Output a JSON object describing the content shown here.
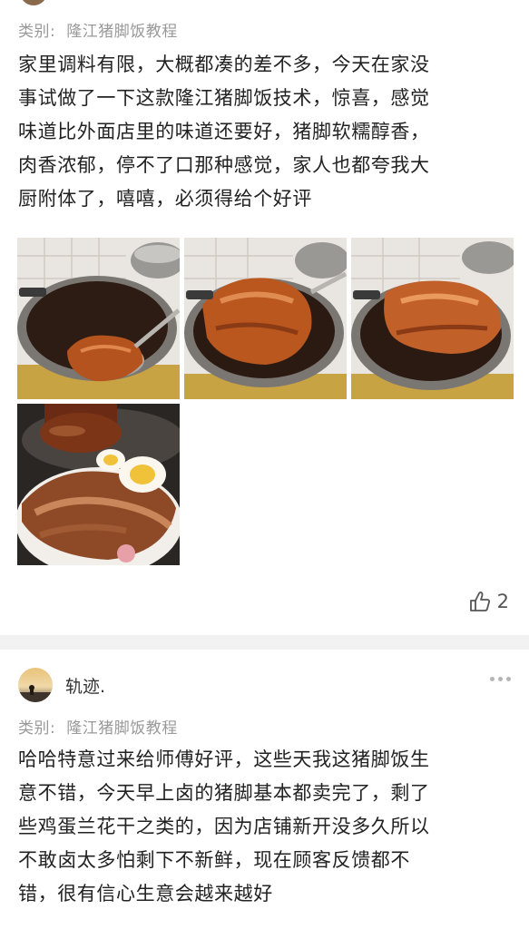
{
  "post1": {
    "category_label": "类别:",
    "category_value": "隆江猪脚饭教程",
    "review_lines": [
      "家里调料有限，大概都凑的差不多，今天在家没",
      "事试做了一下这款隆江猪脚饭技术，惊喜，感觉",
      "味道比外面店里的味道还要好，猪脚软糯醇香，",
      "肉香浓郁，停不了口那种感觉，家人也都夸我大",
      "厨附体了，嘻嘻，必须得给个好评"
    ],
    "photos": [
      "pot-photo-1",
      "pot-photo-2",
      "pot-photo-3",
      "rice-bowl-photo"
    ],
    "like_icon": "thumbs-up-icon",
    "like_count": "2"
  },
  "post2": {
    "username": "轨迹.",
    "more_icon": "more-dots-icon",
    "category_label": "类别:",
    "category_value": "隆江猪脚饭教程",
    "review_lines": [
      "哈哈特意过来给师傅好评，这些天我这猪脚饭生",
      "意不错，今天早上卤的猪脚基本都卖完了，剩了",
      "些鸡蛋兰花干之类的，因为店铺新开没多久所以",
      "不敢卤太多怕剩下不新鲜，现在顾客反馈都不",
      "错，很有信心生意会越来越好"
    ]
  },
  "colors": {
    "text": "#222222",
    "muted": "#999999",
    "divider": "#f2f2f2",
    "braise": "#b5531f"
  }
}
